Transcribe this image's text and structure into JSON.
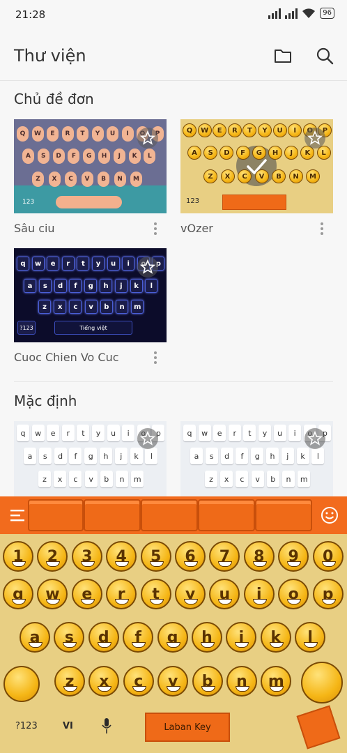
{
  "status": {
    "time": "21:28",
    "battery": "96"
  },
  "header": {
    "title": "Thư viện",
    "folder_icon": "folder-icon",
    "search_icon": "search-icon"
  },
  "sections": {
    "single_themes": {
      "title": "Chủ đề đơn",
      "themes": [
        {
          "name": "Sâu ciu",
          "selected": false
        },
        {
          "name": "vOzer",
          "selected": true
        },
        {
          "name": "Cuoc Chien Vo Cuc",
          "selected": false
        }
      ]
    },
    "default": {
      "title": "Mặc định"
    }
  },
  "thumb_rows": {
    "row1": [
      "Q",
      "W",
      "E",
      "R",
      "T",
      "Y",
      "U",
      "I",
      "O",
      "P"
    ],
    "row2": [
      "A",
      "S",
      "D",
      "F",
      "G",
      "H",
      "J",
      "K",
      "L"
    ],
    "row3": [
      "Z",
      "X",
      "C",
      "V",
      "B",
      "N",
      "M"
    ],
    "row1_lower": [
      "q",
      "w",
      "e",
      "r",
      "t",
      "y",
      "u",
      "i",
      "o",
      "p"
    ],
    "row2_lower": [
      "a",
      "s",
      "d",
      "f",
      "g",
      "h",
      "j",
      "k",
      "l"
    ],
    "row3_lower": [
      "z",
      "x",
      "c",
      "v",
      "b",
      "n",
      "m"
    ],
    "label_123": "123",
    "label_q123": "?123",
    "space_vn": "Tiếng việt"
  },
  "keyboard": {
    "numbers": [
      "1",
      "2",
      "3",
      "4",
      "5",
      "6",
      "7",
      "8",
      "9",
      "0"
    ],
    "row1": [
      "q",
      "w",
      "e",
      "r",
      "t",
      "y",
      "u",
      "i",
      "o",
      "p"
    ],
    "row2": [
      "a",
      "s",
      "d",
      "f",
      "g",
      "h",
      "j",
      "k",
      "l"
    ],
    "row3": [
      "z",
      "x",
      "c",
      "v",
      "b",
      "n",
      "m"
    ],
    "symbols_key": "?123",
    "lang_key": "VI",
    "space_label": "Laban Key",
    "menu_icon": "menu-icon",
    "emoji_icon": "emoji-icon",
    "mic_icon": "mic-icon"
  }
}
